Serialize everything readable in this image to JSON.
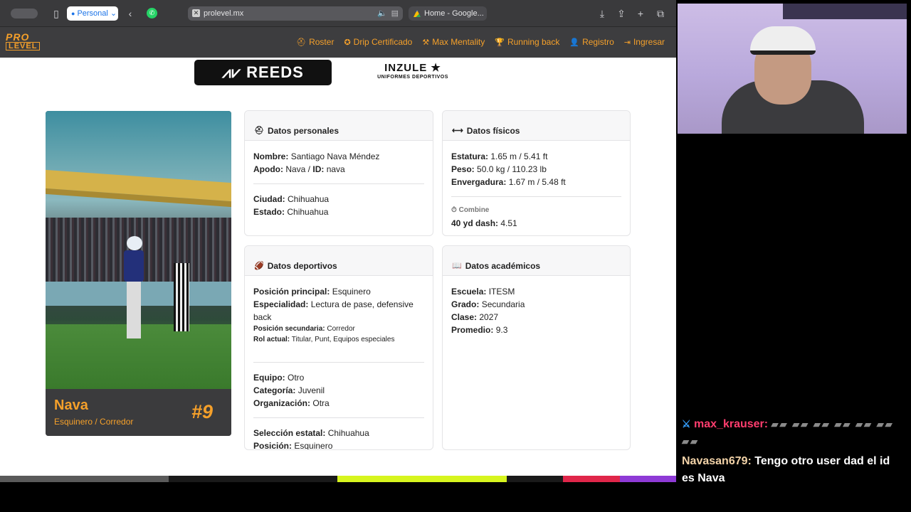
{
  "browser": {
    "profile_label": "Personal",
    "url": "prolevel.mx",
    "second_tab_title": "Home - Google..."
  },
  "site": {
    "logo_top": "PRO",
    "logo_bottom": "LEVEL",
    "nav": [
      {
        "label": "Roster",
        "icon": "helmet-icon"
      },
      {
        "label": "Drip Certificado",
        "icon": "badge-icon"
      },
      {
        "label": "Max Mentality",
        "icon": "dumbbell-icon"
      },
      {
        "label": "Running back",
        "icon": "trophy-icon"
      },
      {
        "label": "Registro",
        "icon": "user-plus-icon"
      },
      {
        "label": "Ingresar",
        "icon": "login-icon"
      }
    ]
  },
  "sponsors": {
    "reeds": "REEDS",
    "inzule_name": "INZULE",
    "inzule_tagline": "UNIFORMES DEPORTIVOS"
  },
  "player": {
    "name": "Nava",
    "positions": "Esquinero / Corredor",
    "number": "#9"
  },
  "personales": {
    "title": "Datos personales",
    "nombre_label": "Nombre:",
    "nombre": "Santiago Nava Méndez",
    "apodo_label": "Apodo:",
    "apodo": "Nava",
    "id_label": "ID:",
    "id": "nava",
    "ciudad_label": "Ciudad:",
    "ciudad": "Chihuahua",
    "estado_label": "Estado:",
    "estado": "Chihuahua"
  },
  "fisicos": {
    "title": "Datos físicos",
    "estatura_label": "Estatura:",
    "estatura": "1.65 m / 5.41 ft",
    "peso_label": "Peso:",
    "peso": "50.0 kg / 110.23 lb",
    "envergadura_label": "Envergadura:",
    "envergadura": "1.67 m / 5.48 ft",
    "combine_label": "Combine",
    "dash_label": "40 yd dash:",
    "dash": "4.51"
  },
  "deportivos": {
    "title": "Datos deportivos",
    "posicion_principal_label": "Posición principal:",
    "posicion_principal": "Esquinero",
    "especialidad_label": "Especialidad:",
    "especialidad": "Lectura de pase, defensive back",
    "posicion_secundaria_label": "Posición secundaria:",
    "posicion_secundaria": "Corredor",
    "rol_label": "Rol actual:",
    "rol": "Titular, Punt, Equipos especiales",
    "equipo_label": "Equipo:",
    "equipo": "Otro",
    "categoria_label": "Categoría:",
    "categoria": "Juvenil",
    "organizacion_label": "Organización:",
    "organizacion": "Otra",
    "seleccion_label": "Selección estatal:",
    "seleccion": "Chihuahua",
    "posicion_label": "Posición:",
    "posicion": "Esquinero"
  },
  "academicos": {
    "title": "Datos académicos",
    "escuela_label": "Escuela:",
    "escuela": "ITESM",
    "grado_label": "Grado:",
    "grado": "Secundaria",
    "clase_label": "Clase:",
    "clase": "2027",
    "promedio_label": "Promedio:",
    "promedio": "9.3"
  },
  "chat": [
    {
      "user": "max_krauser:",
      "message": ""
    },
    {
      "user": "Navasan679:",
      "message": "Tengo otro user dad el id es Nava"
    }
  ],
  "colors": {
    "accent": "#f5a02a",
    "navbar": "#3d3d3f",
    "chat_user1": "#ff3d6e",
    "chat_user2": "#f3d3a8"
  }
}
